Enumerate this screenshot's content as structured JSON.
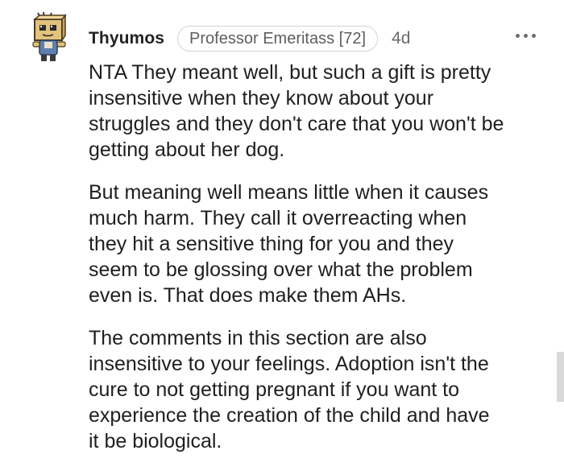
{
  "comment": {
    "username": "Thyumos",
    "flair": "Professor Emeritass [72]",
    "age": "4d",
    "more_icon": "more-horizontal-icon",
    "avatar_icon": "snoo-avatar-icon",
    "paragraphs": [
      "NTA They meant well, but such a gift is pretty\ninsensitive when they know about your\nstruggles and they don't care that you won't be\ngetting about her dog.",
      "But meaning well means little when it causes\nmuch harm. They call it overreacting when\nthey hit a sensitive thing for you and they\nseem to be glossing over what the problem\neven is. That does make them AHs.",
      "The comments in this section are also\ninsensitive to your feelings. Adoption isn't the\ncure to not getting pregnant if you want to\nexperience the creation of the child and have\nit be biological."
    ]
  },
  "colors": {
    "username": "#222222",
    "flair_text": "#5e5e5e",
    "flair_border": "#d4d4d4",
    "body_text": "#1f1f1f",
    "meta_text": "#6a6a6a"
  }
}
